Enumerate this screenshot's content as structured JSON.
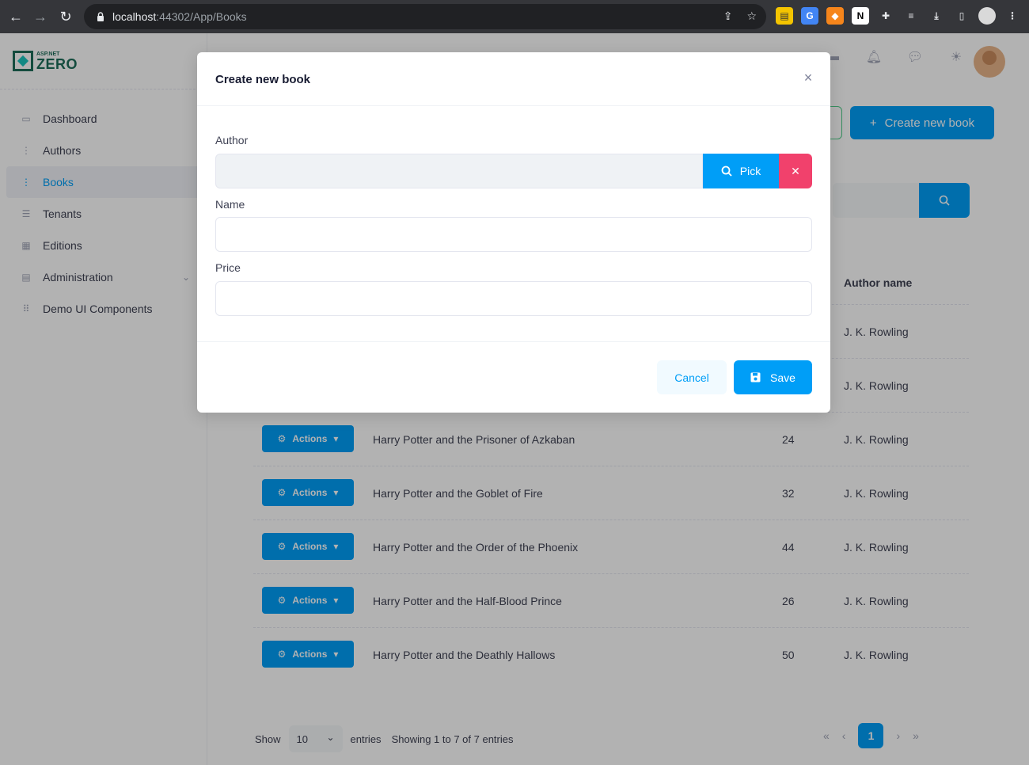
{
  "browser": {
    "url_host": "localhost",
    "url_path": ":44302/App/Books"
  },
  "sidebar": {
    "logo_small": "ASP.NET",
    "logo_big": "ZERO",
    "items": [
      {
        "label": "Dashboard",
        "icon": "chart-icon"
      },
      {
        "label": "Authors",
        "icon": "dots-icon"
      },
      {
        "label": "Books",
        "icon": "dots-icon",
        "active": true
      },
      {
        "label": "Tenants",
        "icon": "list-icon"
      },
      {
        "label": "Editions",
        "icon": "grid-icon"
      },
      {
        "label": "Administration",
        "icon": "layers-icon"
      },
      {
        "label": "Demo UI Components",
        "icon": "apps-icon"
      }
    ]
  },
  "header": {
    "create_label": "Create new book"
  },
  "table": {
    "author_col": "Author name",
    "action_label": "Actions",
    "rows": [
      {
        "name": "",
        "price": "",
        "author": "J. K. Rowling"
      },
      {
        "name": "",
        "price": "",
        "author": "J. K. Rowling"
      },
      {
        "name": "Harry Potter and the Prisoner of Azkaban",
        "price": "24",
        "author": "J. K. Rowling"
      },
      {
        "name": "Harry Potter and the Goblet of Fire",
        "price": "32",
        "author": "J. K. Rowling"
      },
      {
        "name": "Harry Potter and the Order of the Phoenix",
        "price": "44",
        "author": "J. K. Rowling"
      },
      {
        "name": "Harry Potter and the Half-Blood Prince",
        "price": "26",
        "author": "J. K. Rowling"
      },
      {
        "name": "Harry Potter and the Deathly Hallows",
        "price": "50",
        "author": "J. K. Rowling"
      }
    ]
  },
  "footer": {
    "show_label": "Show",
    "page_size": "10",
    "entries_label": "entries",
    "showing_text": "Showing 1 to 7 of 7 entries",
    "current_page": "1"
  },
  "modal": {
    "title": "Create new book",
    "author_label": "Author",
    "pick_label": "Pick",
    "name_label": "Name",
    "price_label": "Price",
    "cancel_label": "Cancel",
    "save_label": "Save"
  },
  "colors": {
    "primary": "#009ef7",
    "danger": "#f1416c",
    "brand": "#1d6e5a"
  }
}
